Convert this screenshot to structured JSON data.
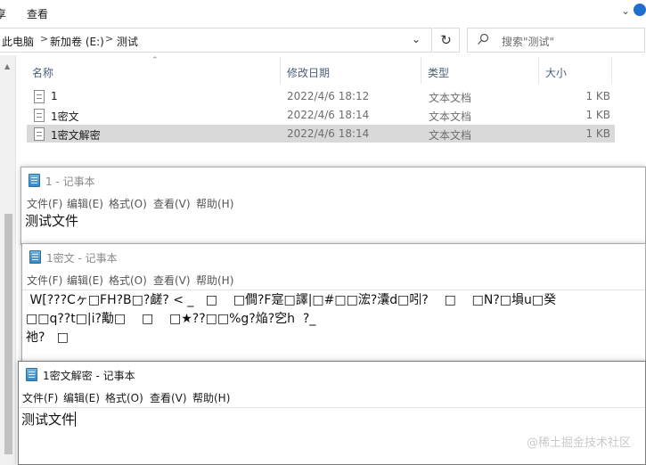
{
  "explorer": {
    "ribbon": {
      "tab_partial": "享",
      "view_tab": "查看"
    },
    "address": {
      "crumbs": [
        "此电脑",
        "新加卷 (E:)",
        "测试"
      ]
    },
    "search": {
      "placeholder": "搜索\"测试\""
    },
    "columns": {
      "name": "名称",
      "modified": "修改日期",
      "type": "类型",
      "size": "大小"
    },
    "files": [
      {
        "name": "1",
        "modified": "2022/4/6 18:12",
        "type": "文本文档",
        "size": "1 KB",
        "selected": false
      },
      {
        "name": "1密文",
        "modified": "2022/4/6 18:14",
        "type": "文本文档",
        "size": "1 KB",
        "selected": false
      },
      {
        "name": "1密文解密",
        "modified": "2022/4/6 18:14",
        "type": "文本文档",
        "size": "1 KB",
        "selected": true
      }
    ]
  },
  "notepads": [
    {
      "title": "1 - 记事本",
      "menu": [
        "文件(F)",
        "编辑(E)",
        "格式(O)",
        "查看(V)",
        "帮助(H)"
      ],
      "content": [
        "测试文件"
      ],
      "active": false
    },
    {
      "title": "1密文 - 记事本",
      "menu": [
        "文件(F)",
        "编辑(E)",
        "格式(O)",
        "查看(V)",
        "帮助(H)"
      ],
      "content": [
        " W[???Cヶ□FH?B□?鹾? < _   □    □僴?F寔□譯|□#□□浤?灢d□吲?    □    □N?□塤u□癸",
        "□□q??t□|i?勱□    □    □★??□□%g?焔?穵h  ?_",
        "祂?   □"
      ],
      "active": false
    },
    {
      "title": "1密文解密 - 记事本",
      "menu": [
        "文件(F)",
        "编辑(E)",
        "格式(O)",
        "查看(V)",
        "帮助(H)"
      ],
      "content": [
        "测试文件"
      ],
      "active": true
    }
  ],
  "watermark": "@稀土掘金技术社区",
  "colors": {
    "selection": "#d9d9d9",
    "header_text": "#4c607a",
    "search_icon": "#555555"
  },
  "icons": [
    "chevron-down-icon",
    "help-icon",
    "refresh-icon",
    "search-icon",
    "text-file-icon",
    "notepad-icon"
  ]
}
